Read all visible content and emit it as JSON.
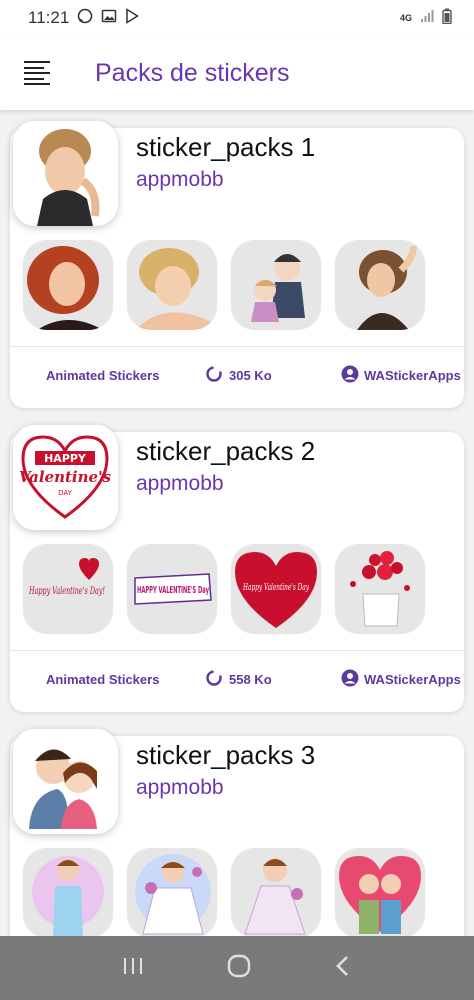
{
  "status_bar": {
    "time": "11:21",
    "network": "4G"
  },
  "header": {
    "title": "Packs de stickers"
  },
  "packs": [
    {
      "name": "sticker_packs 1",
      "author": "appmobb",
      "type_label": "Animated Stickers",
      "size": "305 Ko",
      "publisher": "WAStickerApps"
    },
    {
      "name": "sticker_packs 2",
      "author": "appmobb",
      "type_label": "Animated Stickers",
      "size": "558 Ko",
      "publisher": "WAStickerApps",
      "cover_text": [
        "HAPPY",
        "Valentine's",
        "DAY"
      ],
      "thumb_texts": [
        "Happy Valentine's Day!",
        "HAPPY VALENTINE'S Day",
        "Happy Valentine's Day"
      ]
    },
    {
      "name": "sticker_packs 3",
      "author": "appmobb"
    }
  ],
  "colors": {
    "accent": "#6a35b3",
    "nav_bar": "#7a7a7a"
  }
}
